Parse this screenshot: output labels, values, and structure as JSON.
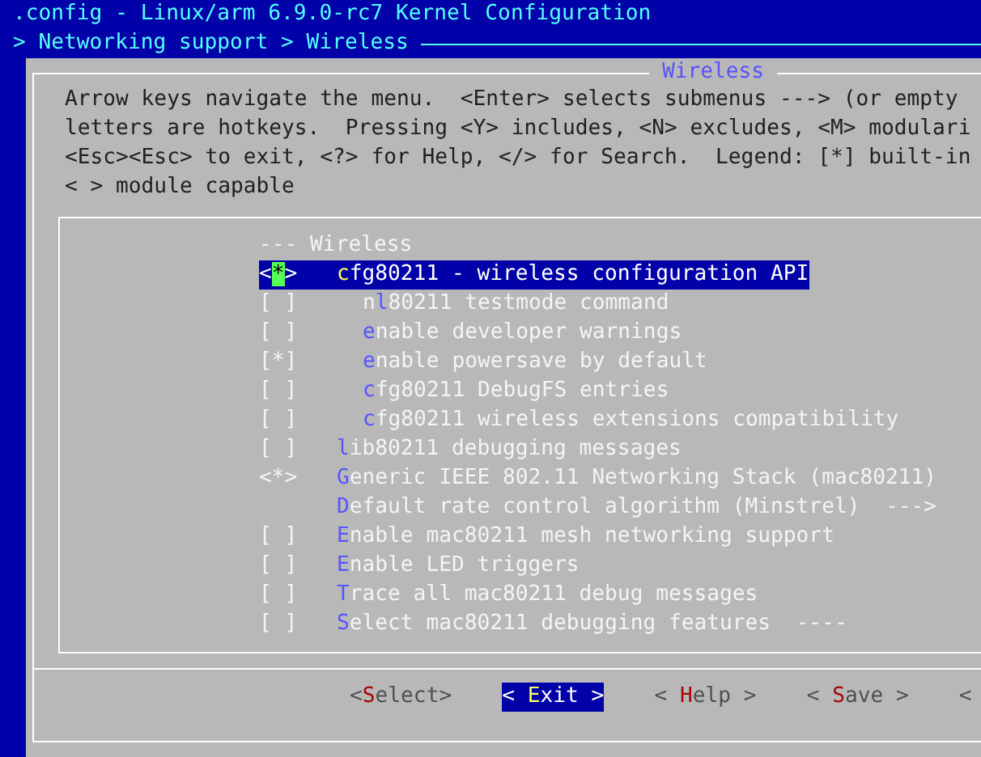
{
  "window": {
    "title": ".config - Linux/arm 6.9.0-rc7 Kernel Configuration"
  },
  "breadcrumb": "> Networking support > Wireless",
  "dialog": {
    "title": "Wireless",
    "help_lines": [
      "Arrow keys navigate the menu.  <Enter> selects submenus ---> (or empty",
      "letters are hotkeys.  Pressing <Y> includes, <N> excludes, <M> modulari",
      "<Esc><Esc> to exit, <?> for Help, </> for Search.  Legend: [*] built-in",
      "< > module capable"
    ],
    "items": [
      {
        "kind": "comment",
        "prefix": "---",
        "text": "Wireless",
        "selected": false
      },
      {
        "kind": "option",
        "prefix": "<*>",
        "text": "**c**fg80211 - wireless configuration API",
        "selected": true,
        "children": [
          {
            "kind": "option",
            "prefix": "[ ]",
            "text": "n**l**80211 testmode command",
            "selected": false
          },
          {
            "kind": "option",
            "prefix": "[ ]",
            "text": "**e**nable developer warnings",
            "selected": false
          },
          {
            "kind": "option",
            "prefix": "[*]",
            "text": "**e**nable powersave by default",
            "selected": false
          },
          {
            "kind": "option",
            "prefix": "[ ]",
            "text": "**c**fg80211 DebugFS entries",
            "selected": false
          },
          {
            "kind": "option",
            "prefix": "[ ]",
            "text": "**c**fg80211 wireless extensions compatibility",
            "selected": false
          }
        ]
      },
      {
        "kind": "option",
        "prefix": "[ ]",
        "text": "**l**ib80211 debugging messages",
        "selected": false
      },
      {
        "kind": "option",
        "prefix": "<*>",
        "text": "**G**eneric IEEE 802.11 Networking Stack (mac80211)",
        "selected": false
      },
      {
        "kind": "option",
        "text": "**D**efault rate control algorithm (Minstrel)  --->",
        "selected": false
      },
      {
        "kind": "option",
        "prefix": "[ ]",
        "text": "**E**nable mac80211 mesh networking support",
        "selected": false
      },
      {
        "kind": "option",
        "prefix": "[ ]",
        "text": "**E**nable LED triggers",
        "selected": false
      },
      {
        "kind": "option",
        "prefix": "[ ]",
        "text": "**T**race all mac80211 debug messages",
        "selected": false
      },
      {
        "kind": "option",
        "prefix": "[ ]",
        "text": "**S**elect mac80211 debugging features  ----",
        "selected": false
      }
    ],
    "buttons": [
      {
        "label": "<**S**elect>",
        "selected": false
      },
      {
        "label": "< **E**xit >",
        "selected": true
      },
      {
        "label": "< **H**elp >",
        "selected": false
      },
      {
        "label": "< **S**ave >",
        "selected": false
      },
      {
        "label": "<",
        "selected": false
      }
    ]
  }
}
